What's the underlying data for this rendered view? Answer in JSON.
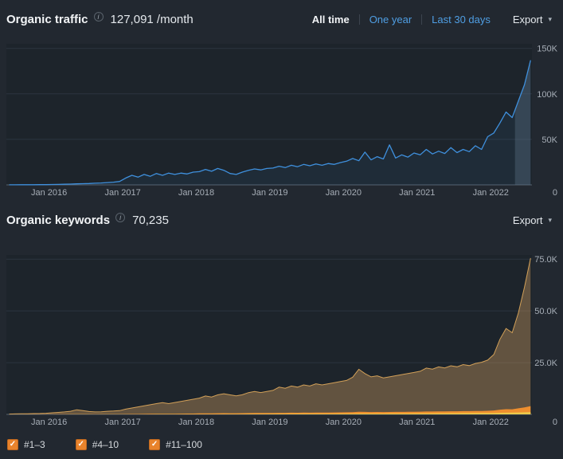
{
  "traffic": {
    "title": "Organic traffic",
    "info": "i",
    "value": "127,091 /month",
    "tabs": {
      "all_time": "All time",
      "one_year": "One year",
      "last_30_days": "Last 30 days"
    },
    "export_label": "Export",
    "export_caret": "▾"
  },
  "keywords": {
    "title": "Organic keywords",
    "info": "i",
    "value": "70,235",
    "export_label": "Export",
    "export_caret": "▾"
  },
  "legend": {
    "check_glyph": "✓",
    "items": [
      {
        "label": "#1–3",
        "checked": true
      },
      {
        "label": "#4–10",
        "checked": true
      },
      {
        "label": "#11–100",
        "checked": true
      }
    ]
  },
  "colors": {
    "background": "#222830",
    "plot_background": "#1d242b",
    "gridline": "#2d3540",
    "axis": "#57626e",
    "tick_text": "#a7aeb7",
    "accent_blue": "#3f90dd",
    "link_blue": "#4f9ee3",
    "checkbox_orange": "#e8832c",
    "area_tan": "#c4965d",
    "area_orange": "#ef8f2f",
    "area_yellow": "#ecc94b",
    "highlight_band": "rgba(90,110,130,0.4)"
  },
  "chart_data": [
    {
      "type": "line",
      "title": "Organic traffic",
      "unit": "visits/month",
      "x_start": 2015.4583,
      "x_step": 0.0833333,
      "x_range": [
        2015.42,
        2022.56
      ],
      "x_tick_values": [
        2016,
        2017,
        2018,
        2019,
        2020,
        2021,
        2022
      ],
      "x_tick_labels": [
        "Jan 2016",
        "Jan 2017",
        "Jan 2018",
        "Jan 2019",
        "Jan 2020",
        "Jan 2021",
        "Jan 2022"
      ],
      "ylim": [
        0,
        155000
      ],
      "y_ticks": [
        0,
        50000,
        100000,
        150000
      ],
      "y_tick_labels": [
        "0",
        "50K",
        "100K",
        "150K"
      ],
      "line_color": "#3f90dd",
      "highlight_band_start": 2022.33,
      "values": [
        100,
        120,
        150,
        180,
        200,
        250,
        300,
        400,
        550,
        700,
        900,
        1100,
        1300,
        1500,
        1800,
        2100,
        2500,
        3000,
        3800,
        7500,
        10500,
        8500,
        11500,
        9500,
        12500,
        10500,
        13000,
        11500,
        13000,
        12000,
        14000,
        14500,
        17000,
        15000,
        18000,
        16000,
        12500,
        11500,
        14000,
        16000,
        17500,
        16500,
        18000,
        18500,
        20500,
        19000,
        21500,
        20000,
        22500,
        21000,
        23000,
        21500,
        23500,
        22500,
        24500,
        26000,
        29000,
        26500,
        36000,
        27500,
        31000,
        28500,
        44000,
        29500,
        33000,
        30500,
        35000,
        33000,
        39000,
        34000,
        37000,
        34500,
        41000,
        35500,
        39000,
        36500,
        43000,
        39000,
        53000,
        57000,
        68000,
        80000,
        74000,
        92000,
        110000,
        137000
      ]
    },
    {
      "type": "stacked_area",
      "title": "Organic keywords",
      "unit": "keywords",
      "x_start": 2015.4583,
      "x_step": 0.0833333,
      "x_range": [
        2015.42,
        2022.56
      ],
      "x_tick_values": [
        2016,
        2017,
        2018,
        2019,
        2020,
        2021,
        2022
      ],
      "x_tick_labels": [
        "Jan 2016",
        "Jan 2017",
        "Jan 2018",
        "Jan 2019",
        "Jan 2020",
        "Jan 2021",
        "Jan 2022"
      ],
      "ylim": [
        0,
        77000
      ],
      "y_ticks": [
        0,
        25000,
        50000,
        75000
      ],
      "y_tick_labels": [
        "0",
        "25.0K",
        "50.0K",
        "75.0K"
      ],
      "legend_position": "bottom",
      "series": [
        {
          "name": "#1–3",
          "color": "#ecc94b",
          "values": [
            2,
            3,
            4,
            5,
            6,
            8,
            10,
            12,
            15,
            18,
            20,
            25,
            22,
            20,
            18,
            20,
            22,
            25,
            28,
            35,
            40,
            45,
            50,
            55,
            60,
            65,
            70,
            75,
            80,
            85,
            90,
            100,
            110,
            120,
            130,
            140,
            150,
            160,
            170,
            180,
            190,
            200,
            210,
            220,
            230,
            240,
            250,
            260,
            270,
            280,
            290,
            300,
            310,
            320,
            330,
            340,
            360,
            380,
            400,
            380,
            390,
            400,
            410,
            420,
            430,
            440,
            450,
            460,
            480,
            500,
            520,
            540,
            560,
            580,
            600,
            620,
            640,
            660,
            680,
            700,
            760,
            820,
            880,
            940,
            1000,
            1100
          ]
        },
        {
          "name": "#4–10",
          "color": "#ef8f2f",
          "values": [
            10,
            12,
            15,
            18,
            20,
            25,
            30,
            40,
            50,
            60,
            80,
            100,
            90,
            70,
            60,
            65,
            70,
            80,
            90,
            120,
            140,
            160,
            180,
            200,
            220,
            240,
            230,
            250,
            270,
            290,
            310,
            350,
            380,
            360,
            400,
            420,
            400,
            380,
            400,
            440,
            460,
            440,
            460,
            480,
            520,
            500,
            540,
            520,
            560,
            540,
            580,
            560,
            580,
            600,
            620,
            650,
            720,
            900,
            800,
            740,
            760,
            720,
            740,
            760,
            780,
            800,
            820,
            850,
            900,
            880,
            920,
            900,
            940,
            920,
            960,
            940,
            980,
            1000,
            1050,
            1200,
            1500,
            1700,
            1600,
            2000,
            2400,
            2900
          ]
        },
        {
          "name": "#11–100",
          "color": "#c4965d",
          "values": [
            150,
            200,
            250,
            300,
            350,
            400,
            500,
            700,
            900,
            1100,
            1400,
            2100,
            1700,
            1300,
            1100,
            1200,
            1400,
            1500,
            1700,
            2400,
            2900,
            3400,
            3900,
            4400,
            4900,
            5400,
            4900,
            5400,
            5900,
            6400,
            6900,
            7400,
            8400,
            7900,
            8900,
            9400,
            8900,
            8400,
            8900,
            9900,
            10400,
            9900,
            10400,
            10900,
            12400,
            11900,
            12900,
            12400,
            13400,
            12900,
            13900,
            13400,
            13900,
            14400,
            14900,
            15400,
            16900,
            20500,
            18500,
            17000,
            17500,
            16500,
            17000,
            17500,
            18000,
            18500,
            19000,
            19500,
            21000,
            20500,
            21500,
            21000,
            22000,
            21500,
            22500,
            22000,
            23000,
            23500,
            24500,
            27000,
            34000,
            39000,
            37000,
            46000,
            58000,
            71500
          ]
        }
      ]
    }
  ]
}
